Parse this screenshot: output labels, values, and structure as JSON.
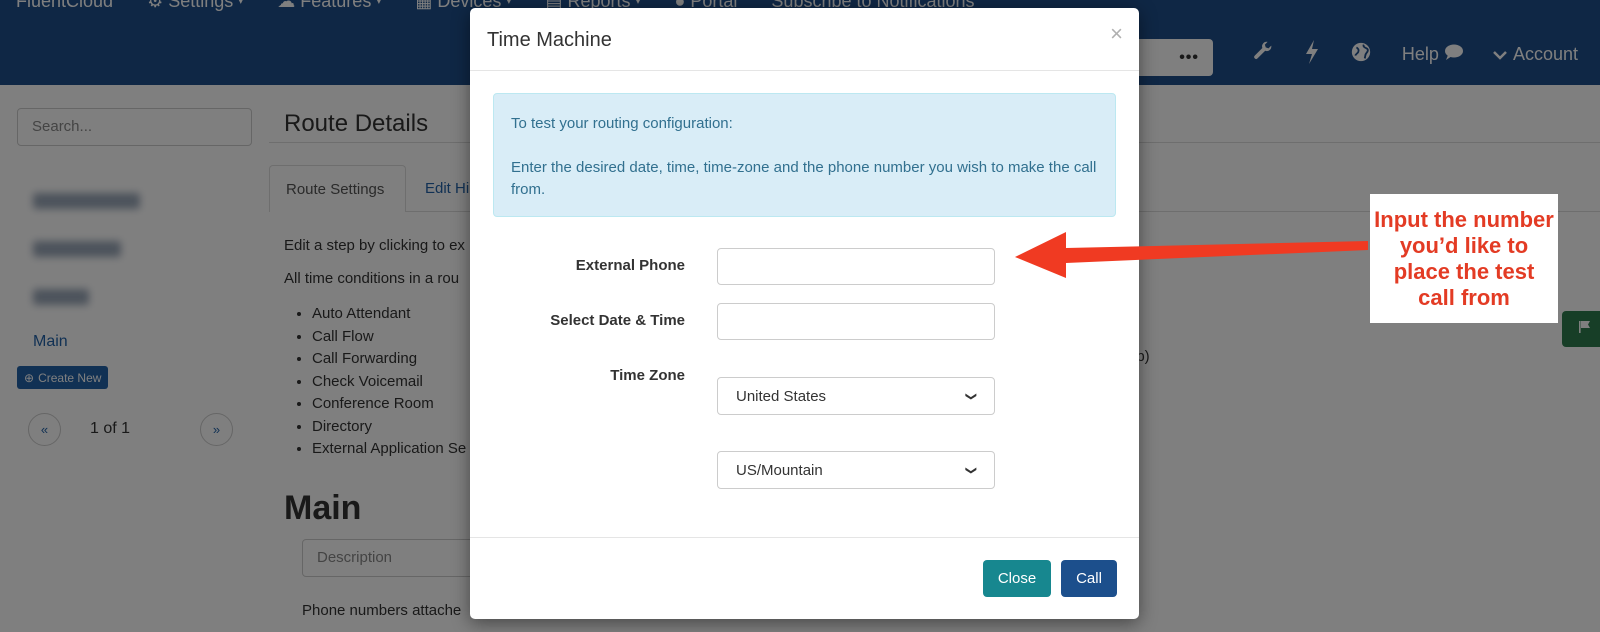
{
  "nav": {
    "brand": "FluentCloud",
    "menu": [
      {
        "label": "Settings",
        "icon": "gear-icon"
      },
      {
        "label": "Features",
        "icon": "cloud-icon"
      },
      {
        "label": "Devices",
        "icon": "devices-icon"
      },
      {
        "label": "Reports",
        "icon": "chart-icon"
      },
      {
        "label": "Portal",
        "icon": "user-icon"
      },
      {
        "label": "Subscribe to Notifications",
        "icon": ""
      }
    ],
    "search_more": "•••",
    "help": "Help",
    "account": "Account"
  },
  "sidebar": {
    "search_placeholder": "Search...",
    "main_link": "Main",
    "create_new": "Create New",
    "pager": {
      "prev": "«",
      "text": "1 of 1",
      "next": "»"
    }
  },
  "content": {
    "title": "Route Details",
    "tabs": [
      "Route Settings",
      "Edit Hi"
    ],
    "line1": "Edit a step by clicking to ex",
    "line2": "All time conditions in a rou",
    "steps": [
      "Auto Attendant",
      "Call Flow",
      "Call Forwarding",
      "Check Voicemail",
      "Conference Room",
      "Directory",
      "External Application Se"
    ],
    "right_fragment": "ep)",
    "heading": "Main",
    "description_placeholder": "Description",
    "phone_line": "Phone numbers attache"
  },
  "modal": {
    "title": "Time Machine",
    "close_symbol": "×",
    "alert_line1": "To test your routing configuration:",
    "alert_line2": "Enter the desired date, time, time-zone and the phone number you wish to make the call from.",
    "labels": {
      "external_phone": "External Phone",
      "date_time": "Select Date & Time",
      "time_zone": "Time Zone"
    },
    "values": {
      "external_phone": "",
      "date_time": "",
      "country": "United States",
      "zone": "US/Mountain"
    },
    "buttons": {
      "close": "Close",
      "call": "Call"
    }
  },
  "annotation": {
    "text": "Input the number you’d like to place the test call from",
    "color": "#e33b24"
  }
}
